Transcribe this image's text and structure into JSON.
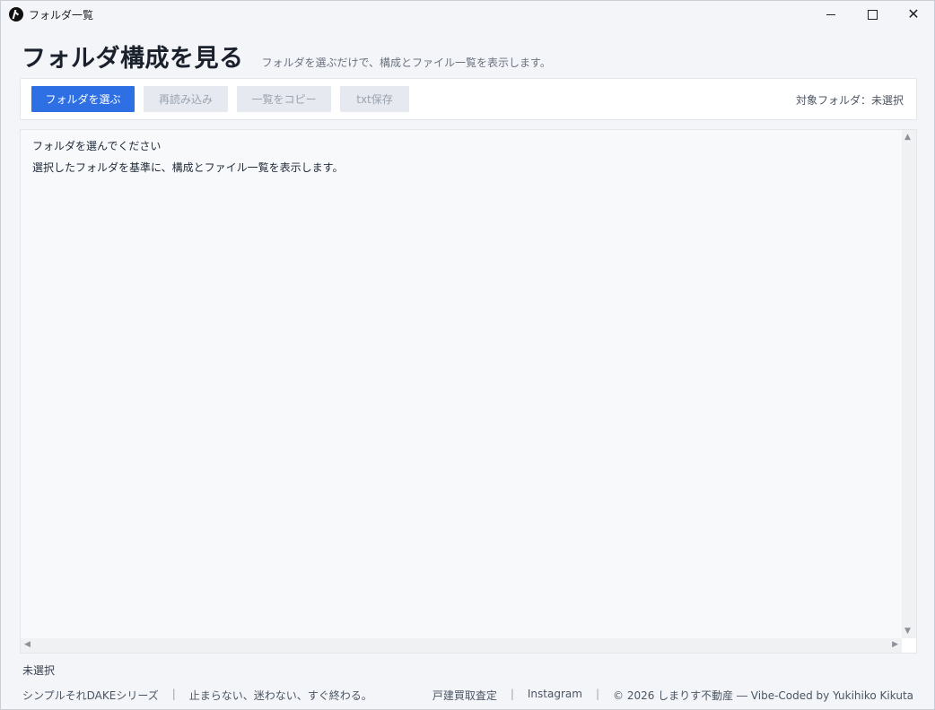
{
  "window": {
    "title": "フォルダ一覧",
    "icon": "app-logo-icon",
    "controls": {
      "minimize": "minimize-icon",
      "maximize": "maximize-icon",
      "close": "close-icon"
    }
  },
  "header": {
    "title": "フォルダ構成を見る",
    "subtitle": "フォルダを選ぶだけで、構成とファイル一覧を表示します。"
  },
  "toolbar": {
    "select_folder": "フォルダを選ぶ",
    "reload": "再読み込み",
    "copy_list": "一覧をコピー",
    "save_txt": "txt保存",
    "target_folder": "対象フォルダ：未選択"
  },
  "output": {
    "line1": "フォルダを選んでください",
    "line2": "選択したフォルダを基準に、構成とファイル一覧を表示します。"
  },
  "status": "未選択",
  "footer": {
    "series": "シンプルそれDAKEシリーズ",
    "separator": "|",
    "tagline": "止まらない、迷わない、すぐ終わる。",
    "link1": "戸建買取査定",
    "link2": "Instagram",
    "copyright": "© 2026 しまりす不動産 ― Vibe-Coded by Yukihiko Kikuta"
  },
  "colors": {
    "primary": "#2f6fe4",
    "disabled_bg": "#e6e9ef",
    "background": "#f3f5f8"
  }
}
